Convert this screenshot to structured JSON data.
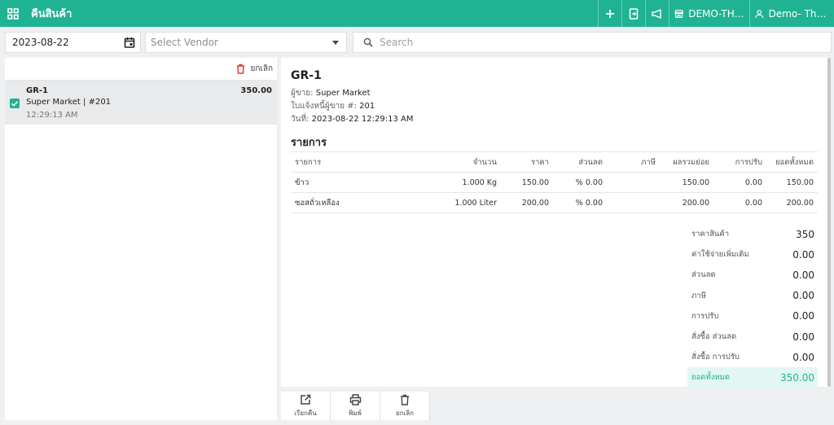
{
  "topbar": {
    "title": "คืนสินค้า",
    "store_label": "DEMO-THAI...",
    "user_label": "Demo- Thail..."
  },
  "filters": {
    "date": "2023-08-22",
    "vendor_placeholder": "Select Vendor",
    "search_placeholder": "Search"
  },
  "list": {
    "cancel_label": "ยกเลิก",
    "items": [
      {
        "id": "GR-1",
        "vendor": "Super Market | #201",
        "time": "12:29:13 AM",
        "amount": "350.00",
        "checked": true
      }
    ]
  },
  "detail": {
    "title": "GR-1",
    "vendor_label": "ผู้ขาย:",
    "vendor_value": "Super Market",
    "invoice_label": "ใบแจ้งหนี้ผู้ขาย #:",
    "invoice_value": "201",
    "date_label": "วันที่:",
    "date_value": "2023-08-22 12:29:13 AM",
    "section_title": "รายการ",
    "columns": [
      "รายการ",
      "จำนวน",
      "ราคา",
      "ส่วนลด",
      "ภาษี",
      "ผลรวมย่อย",
      "การปรับ",
      "ยอดทั้งหมด"
    ],
    "rows": [
      [
        "ข้าว",
        "1.000 Kg",
        "150.00",
        "% 0.00",
        "",
        "150.00",
        "0.00",
        "150.00"
      ],
      [
        "ซอสถั่วเหลือง",
        "1.000 Liter",
        "200.00",
        "% 0.00",
        "",
        "200.00",
        "0.00",
        "200.00"
      ]
    ],
    "summary": [
      {
        "label": "ราคาสินค้า",
        "value": "350"
      },
      {
        "label": "ค่าใช้จ่ายเพิ่มเติม",
        "value": "0.00"
      },
      {
        "label": "ส่วนลด",
        "value": "0.00"
      },
      {
        "label": "ภาษี",
        "value": "0.00"
      },
      {
        "label": "การปรับ",
        "value": "0.00"
      },
      {
        "label": "สั่งซื้อ ส่วนลด",
        "value": "0.00"
      },
      {
        "label": "สั่งซื้อ การปรับ",
        "value": "0.00"
      },
      {
        "label": "ยอดทั้งหมด",
        "value": "350.00"
      }
    ]
  },
  "actions": {
    "reopen_label": "เรียกคืน",
    "print_label": "พิมพ์",
    "cancel_label": "ยกเลิก"
  },
  "colors": {
    "accent": "#1fb394",
    "danger": "#e53935"
  }
}
